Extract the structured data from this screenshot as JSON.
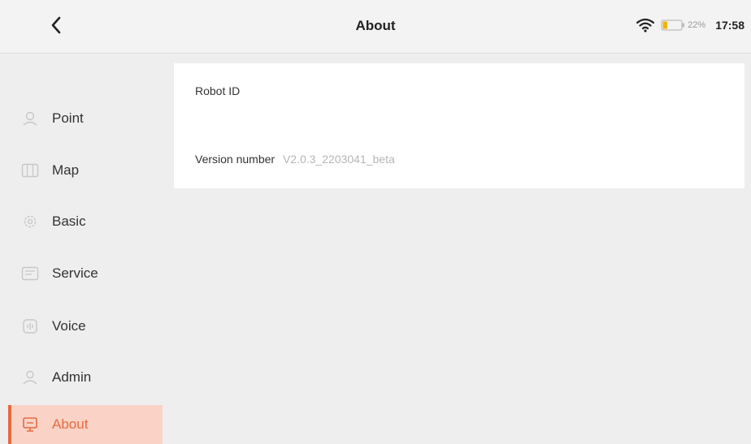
{
  "header": {
    "title": "About",
    "battery_percent": "22%",
    "time": "17:58",
    "icons": {
      "back": "chevron-left-icon",
      "wifi": "wifi-icon",
      "battery": "battery-icon"
    }
  },
  "sidebar": {
    "items": [
      {
        "label": "Point",
        "icon": "location-icon",
        "active": false
      },
      {
        "label": "Map",
        "icon": "map-icon",
        "active": false
      },
      {
        "label": "Basic",
        "icon": "gear-icon",
        "active": false
      },
      {
        "label": "Service",
        "icon": "service-icon",
        "active": false
      },
      {
        "label": "Voice",
        "icon": "voice-icon",
        "active": false
      },
      {
        "label": "Admin",
        "icon": "user-icon",
        "active": false
      },
      {
        "label": "About",
        "icon": "info-icon",
        "active": true
      }
    ]
  },
  "about": {
    "robot_id_label": "Robot ID",
    "robot_id_value": "",
    "version_label": "Version number",
    "version_value": "V2.0.3_2203041_beta"
  },
  "colors": {
    "accent": "#e8693f",
    "active_bg": "#fbd3c6",
    "background": "#eeeeee",
    "card": "#ffffff",
    "battery_fill": "#f0b400"
  }
}
